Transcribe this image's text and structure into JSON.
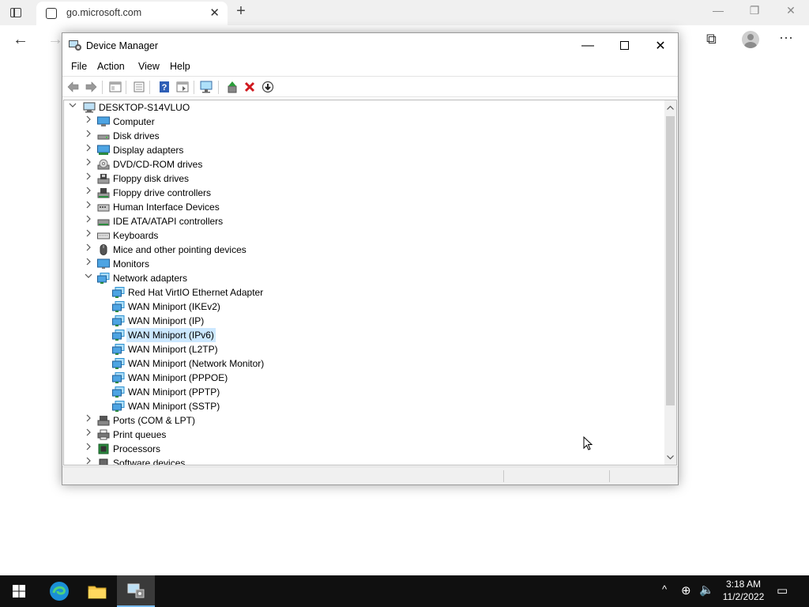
{
  "browser": {
    "tab_title": "go.microsoft.com",
    "tab_close": "✕",
    "new_tab": "+",
    "min": "—",
    "restore": "❐",
    "close": "✕",
    "back": "←",
    "forward": "→",
    "more": "···",
    "collections": "⧉"
  },
  "dm": {
    "title": "Device Manager",
    "controls": {
      "min": "—",
      "close": "✕"
    },
    "menu": [
      "File",
      "Action",
      "View",
      "Help"
    ],
    "root": "DESKTOP-S14VLUO",
    "categories": [
      {
        "label": "Computer",
        "icon": "computer-icon"
      },
      {
        "label": "Disk drives",
        "icon": "disk-drive-icon"
      },
      {
        "label": "Display adapters",
        "icon": "display-adapter-icon"
      },
      {
        "label": "DVD/CD-ROM drives",
        "icon": "dvd-drive-icon"
      },
      {
        "label": "Floppy disk drives",
        "icon": "floppy-disk-icon"
      },
      {
        "label": "Floppy drive controllers",
        "icon": "floppy-controller-icon"
      },
      {
        "label": "Human Interface Devices",
        "icon": "hid-icon"
      },
      {
        "label": "IDE ATA/ATAPI controllers",
        "icon": "ide-controller-icon"
      },
      {
        "label": "Keyboards",
        "icon": "keyboard-icon"
      },
      {
        "label": "Mice and other pointing devices",
        "icon": "mouse-icon"
      },
      {
        "label": "Monitors",
        "icon": "monitor-icon"
      },
      {
        "label": "Network adapters",
        "icon": "network-adapter-icon",
        "expanded": true
      },
      {
        "label": "Ports (COM & LPT)",
        "icon": "port-icon"
      },
      {
        "label": "Print queues",
        "icon": "printer-icon"
      },
      {
        "label": "Processors",
        "icon": "processor-icon"
      },
      {
        "label": "Software devices",
        "icon": "software-device-icon"
      }
    ],
    "network_adapters": [
      "Red Hat VirtIO Ethernet Adapter",
      "WAN Miniport (IKEv2)",
      "WAN Miniport (IP)",
      "WAN Miniport (IPv6)",
      "WAN Miniport (L2TP)",
      "WAN Miniport (Network Monitor)",
      "WAN Miniport (PPPOE)",
      "WAN Miniport (PPTP)",
      "WAN Miniport (SSTP)"
    ],
    "selected_adapter": "WAN Miniport (IPv6)"
  },
  "taskbar": {
    "time": "3:18 AM",
    "date": "11/2/2022",
    "tray_chevron": "^",
    "network_glyph": "⊕",
    "volume_glyph": "🔈",
    "notification_glyph": "▭"
  },
  "colors": {
    "selection": "#cce8ff",
    "taskbar": "#101010",
    "network_icon": "#2a8fd0"
  }
}
